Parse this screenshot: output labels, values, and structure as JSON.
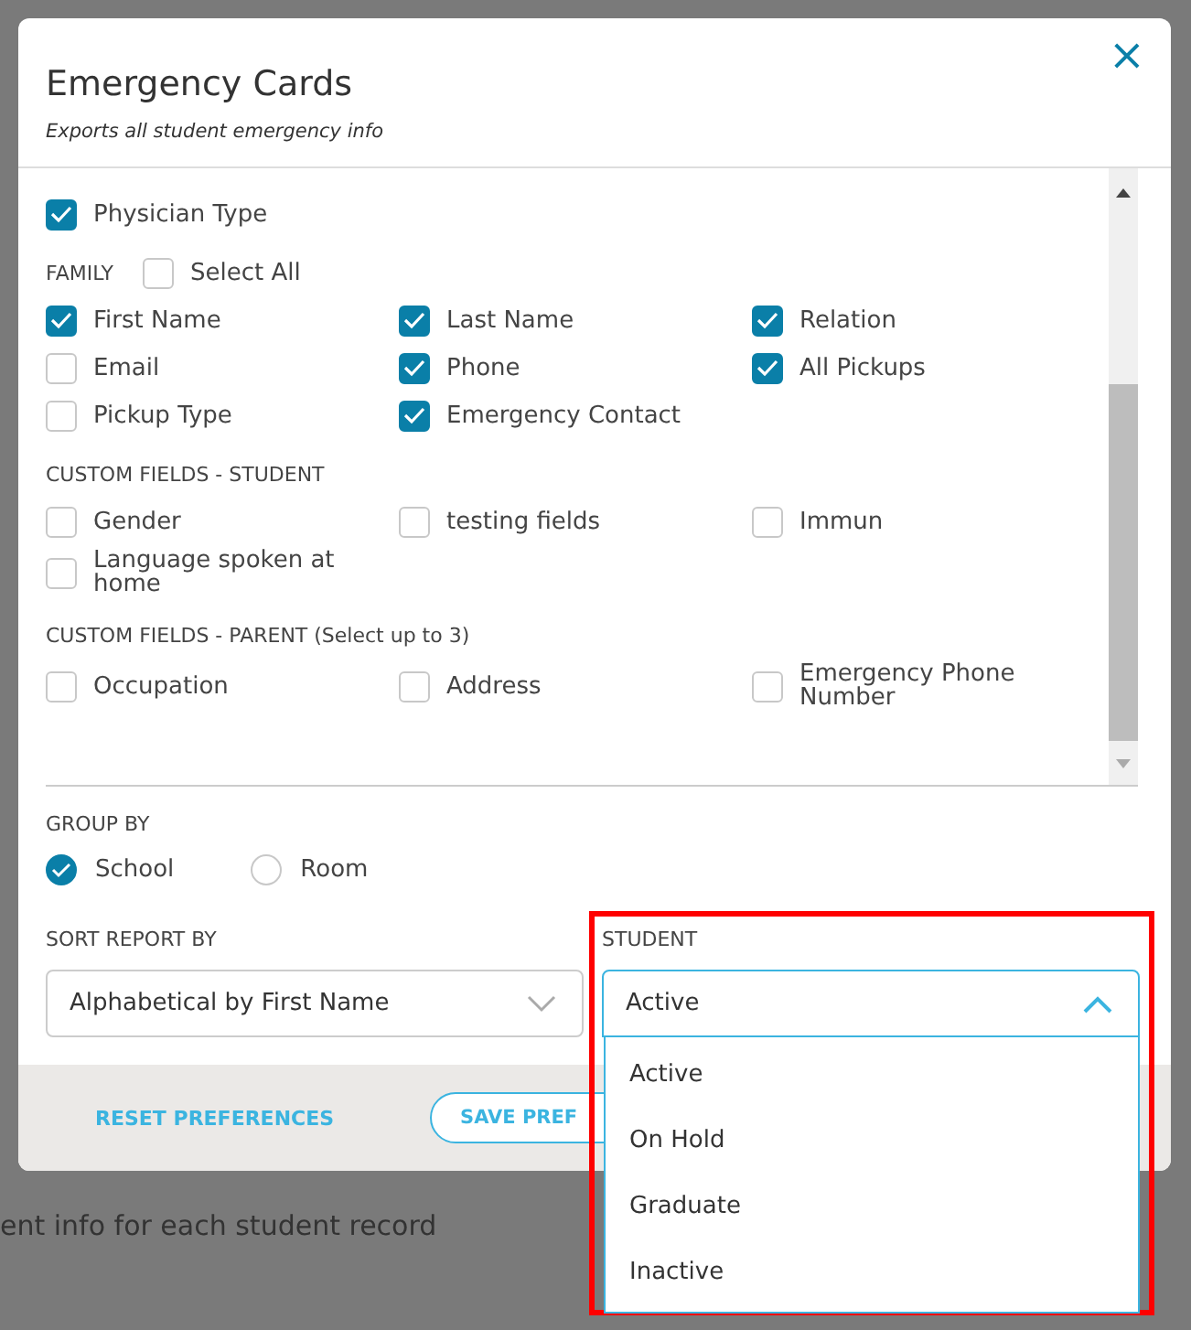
{
  "background": {
    "description": "ent info for each student record"
  },
  "modal": {
    "title": "Emergency Cards",
    "subtitle": "Exports all student emergency info",
    "close": "×"
  },
  "field_groups": [
    {
      "items": [
        {
          "label": "Physician Type",
          "checked": true
        }
      ]
    },
    {
      "heading": "FAMILY",
      "select_all": {
        "label": "Select All",
        "checked": false
      },
      "items": [
        {
          "label": "First Name",
          "checked": true
        },
        {
          "label": "Last Name",
          "checked": true
        },
        {
          "label": "Relation",
          "checked": true
        },
        {
          "label": "Email",
          "checked": false
        },
        {
          "label": "Phone",
          "checked": true
        },
        {
          "label": "All Pickups",
          "checked": true
        },
        {
          "label": "Pickup Type",
          "checked": false
        },
        {
          "label": "Emergency Contact",
          "checked": true
        }
      ]
    },
    {
      "heading": "CUSTOM FIELDS - STUDENT",
      "items": [
        {
          "label": "Gender",
          "checked": false
        },
        {
          "label": "testing fields",
          "checked": false
        },
        {
          "label": "Immun",
          "checked": false
        },
        {
          "label": "Language spoken at home",
          "checked": false
        }
      ]
    },
    {
      "heading": "CUSTOM FIELDS - PARENT (Select up to 3)",
      "items": [
        {
          "label": "Occupation",
          "checked": false
        },
        {
          "label": "Address",
          "checked": false
        },
        {
          "label": "Emergency Phone Number",
          "checked": false
        }
      ]
    }
  ],
  "group_by": {
    "label": "GROUP BY",
    "options": [
      {
        "label": "School",
        "selected": true
      },
      {
        "label": "Room",
        "selected": false
      }
    ]
  },
  "sort": {
    "label": "SORT REPORT BY",
    "value": "Alphabetical by First Name"
  },
  "student": {
    "label": "STUDENT",
    "value": "Active",
    "expanded": true,
    "options": [
      "Active",
      "On Hold",
      "Graduate",
      "Inactive"
    ]
  },
  "footer": {
    "reset": "RESET PREFERENCES",
    "save": "SAVE PREF"
  }
}
